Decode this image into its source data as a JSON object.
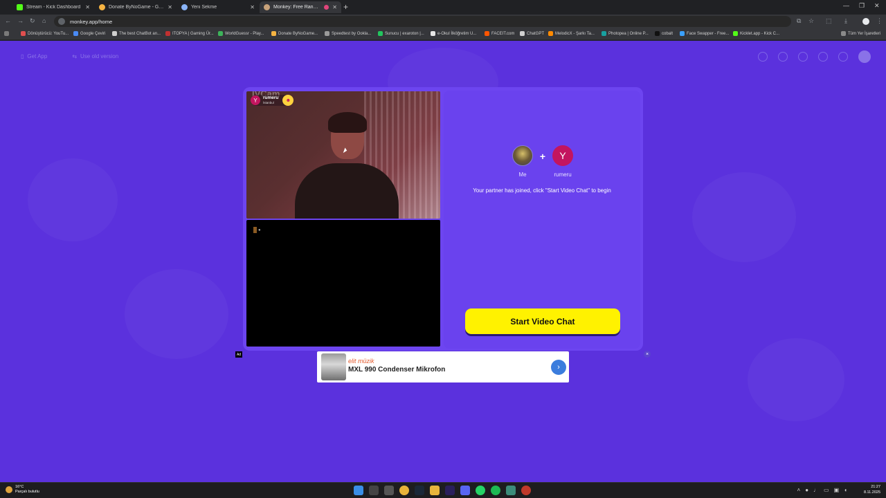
{
  "browser": {
    "tabs": [
      {
        "title": "Stream - Kick Dashboard",
        "color": "#53fc18",
        "active": false
      },
      {
        "title": "Donate ByNoGame - Gelen/Gi",
        "color": "#f5b342",
        "active": false
      },
      {
        "title": "Yeni Sekme",
        "color": "#8ab4f8",
        "active": false
      },
      {
        "title": "Monkey: Free Random Vid",
        "color": "#c8a27a",
        "active": true
      }
    ],
    "url": "monkey.app/home",
    "bookmarks": [
      "Dönüştürücü: YouTu...",
      "Google Çeviri",
      "The best ChatBot an...",
      "ITOPYA | Gaming Ür...",
      "WorldGuessr - Play...",
      "Donate ByNoGame...",
      "Speedtest by Ookla...",
      "Sunucu | exaroton |...",
      "e-Okul İlköğretim U...",
      "FACEIT.com",
      "ChatGPT",
      "MelodicX - Şarkı Ta...",
      "Photopea | Online P...",
      "cobalt",
      "Face Swapper - Free...",
      "Kicklet.app - Kick C..."
    ],
    "all_bookmarks": "Tüm Yer İşaretleri"
  },
  "nav": {
    "get_app": "Get App",
    "old_version": "Use old version"
  },
  "video": {
    "cam_watermark": "IVCam",
    "partner_name": "rumeru",
    "partner_city": "İstanbul",
    "partner_initial": "Y"
  },
  "match": {
    "me_label": "Me",
    "plus": "+",
    "partner_label": "rumeru",
    "partner_initial": "Y",
    "status": "Your partner has joined, click \"Start Video Chat\" to begin",
    "start_button": "Start Video Chat"
  },
  "ad": {
    "tag": "Ad",
    "brand": "elit müzik",
    "title": "MXL 990 Condenser Mikrofon",
    "arrow": "›",
    "close": "×"
  },
  "taskbar": {
    "temp": "16°C",
    "weather": "Parçalı bulutlu",
    "time": "21:27",
    "date": "8.11.2025"
  },
  "colors": {
    "page_bg": "#5b31dd",
    "button_yellow": "#fff200",
    "partner_avatar": "#c3155f"
  }
}
